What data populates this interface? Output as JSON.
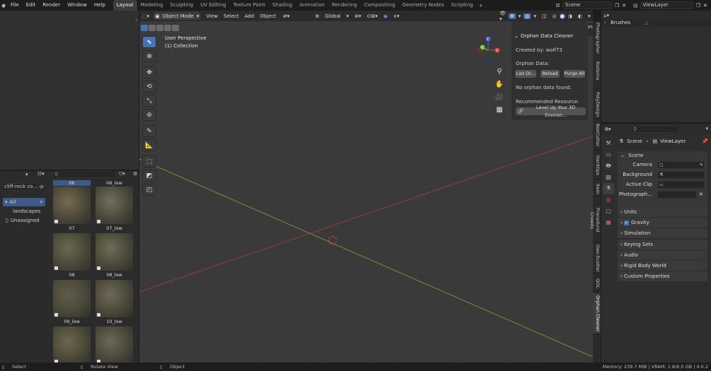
{
  "menu": [
    "File",
    "Edit",
    "Render",
    "Window",
    "Help"
  ],
  "workspaces": [
    "Layout",
    "Modeling",
    "Sculpting",
    "UV Editing",
    "Texture Paint",
    "Shading",
    "Animation",
    "Rendering",
    "Compositing",
    "Geometry Nodes",
    "Scripting"
  ],
  "active_workspace": "Layout",
  "add_workspace": "+",
  "scene_name": "Scene",
  "view_layer": "ViewLayer",
  "viewport": {
    "mode": "Object Mode",
    "menus": [
      "View",
      "Select",
      "Add",
      "Object"
    ],
    "transform": "Global",
    "perspective": "User Perspective",
    "collection": "(1) Collection",
    "options": "Options",
    "gizmo": {
      "x": "X",
      "y": "Y",
      "z": "Z"
    }
  },
  "orphan_panel": {
    "title": "Orphan Data Cleaner",
    "created_by": "Created by: wolf73",
    "orphan_data": "Orphan Data:",
    "buttons": [
      "List Or...",
      "Reload",
      "Purge All"
    ],
    "no_orphan": "No orphan data found.",
    "recommended": "Recommended Resource:",
    "resource_button": "Level Up Your 3D Environ..."
  },
  "sidebar_tabs": [
    "Photographer",
    "Kodama",
    "PolyDesign",
    "BoxCutter",
    "HardOps",
    "Item",
    "Procedural Crowds",
    "Geo-Scatter",
    "QOL",
    "Orphan Cleaner"
  ],
  "outliner": {
    "brushes": "Brushes"
  },
  "properties": {
    "breadcrumb_scene": "Scene",
    "breadcrumb_layer": "ViewLayer",
    "section": "Scene",
    "fields": [
      {
        "label": "Camera",
        "value": ""
      },
      {
        "label": "Background ...",
        "value": ""
      },
      {
        "label": "Active Clip",
        "value": ""
      },
      {
        "label": "Photograph...",
        "value": ""
      }
    ],
    "collapsed": [
      "Units",
      "Gravity",
      "Simulation",
      "Keying Sets",
      "Audio",
      "Rigid Body World",
      "Custom Properties"
    ]
  },
  "asset_browser": {
    "library": "cliff-rock co...",
    "catalogs": [
      "All",
      "landscapes",
      "Unassigned"
    ],
    "assets": [
      "06",
      "06_low",
      "07",
      "07_low",
      "08",
      "08_low",
      "09_low",
      "10_low",
      "",
      ""
    ]
  },
  "status": {
    "select": "Select",
    "rotate": "Rotate View",
    "object": "Object",
    "stats": "Memory: 239.7 MiB | VRAM: 1.8/6.0 GB | 4.0.2"
  }
}
